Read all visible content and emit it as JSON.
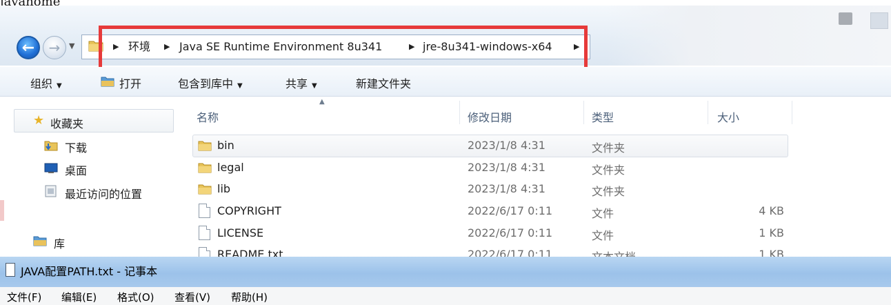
{
  "stub_text": "javahome",
  "breadcrumb": {
    "items": [
      "环境",
      "Java SE Runtime Environment 8u341",
      "jre-8u341-windows-x64"
    ]
  },
  "toolbar": {
    "organize": "组织",
    "open": "打开",
    "include_in_library": "包含到库中",
    "share": "共享",
    "new_folder": "新建文件夹"
  },
  "nav": {
    "favorites": "收藏夹",
    "downloads": "下载",
    "desktop": "桌面",
    "recent": "最近访问的位置",
    "libraries": "库"
  },
  "columns": {
    "name": "名称",
    "date": "修改日期",
    "type": "类型",
    "size": "大小"
  },
  "files": [
    {
      "name": "bin",
      "date": "2023/1/8 4:31",
      "type": "文件夹",
      "size": "",
      "icon": "folder-icon"
    },
    {
      "name": "legal",
      "date": "2023/1/8 4:31",
      "type": "文件夹",
      "size": "",
      "icon": "folder-icon"
    },
    {
      "name": "lib",
      "date": "2023/1/8 4:31",
      "type": "文件夹",
      "size": "",
      "icon": "folder-icon"
    },
    {
      "name": "COPYRIGHT",
      "date": "2022/6/17 0:11",
      "type": "文件",
      "size": "4 KB",
      "icon": "file-icon"
    },
    {
      "name": "LICENSE",
      "date": "2022/6/17 0:11",
      "type": "文件",
      "size": "1 KB",
      "icon": "file-icon"
    },
    {
      "name": "README.txt",
      "date": "2022/6/17 0:11",
      "type": "文本文档",
      "size": "1 KB",
      "icon": "text-file-icon"
    }
  ],
  "notepad": {
    "title": "JAVA配置PATH.txt - 记事本",
    "menu": [
      "文件(F)",
      "编辑(E)",
      "格式(O)",
      "查看(V)",
      "帮助(H)"
    ]
  },
  "colors": {
    "highlight_box": "#e63a3a",
    "title_bar": "#a7c9ec"
  }
}
